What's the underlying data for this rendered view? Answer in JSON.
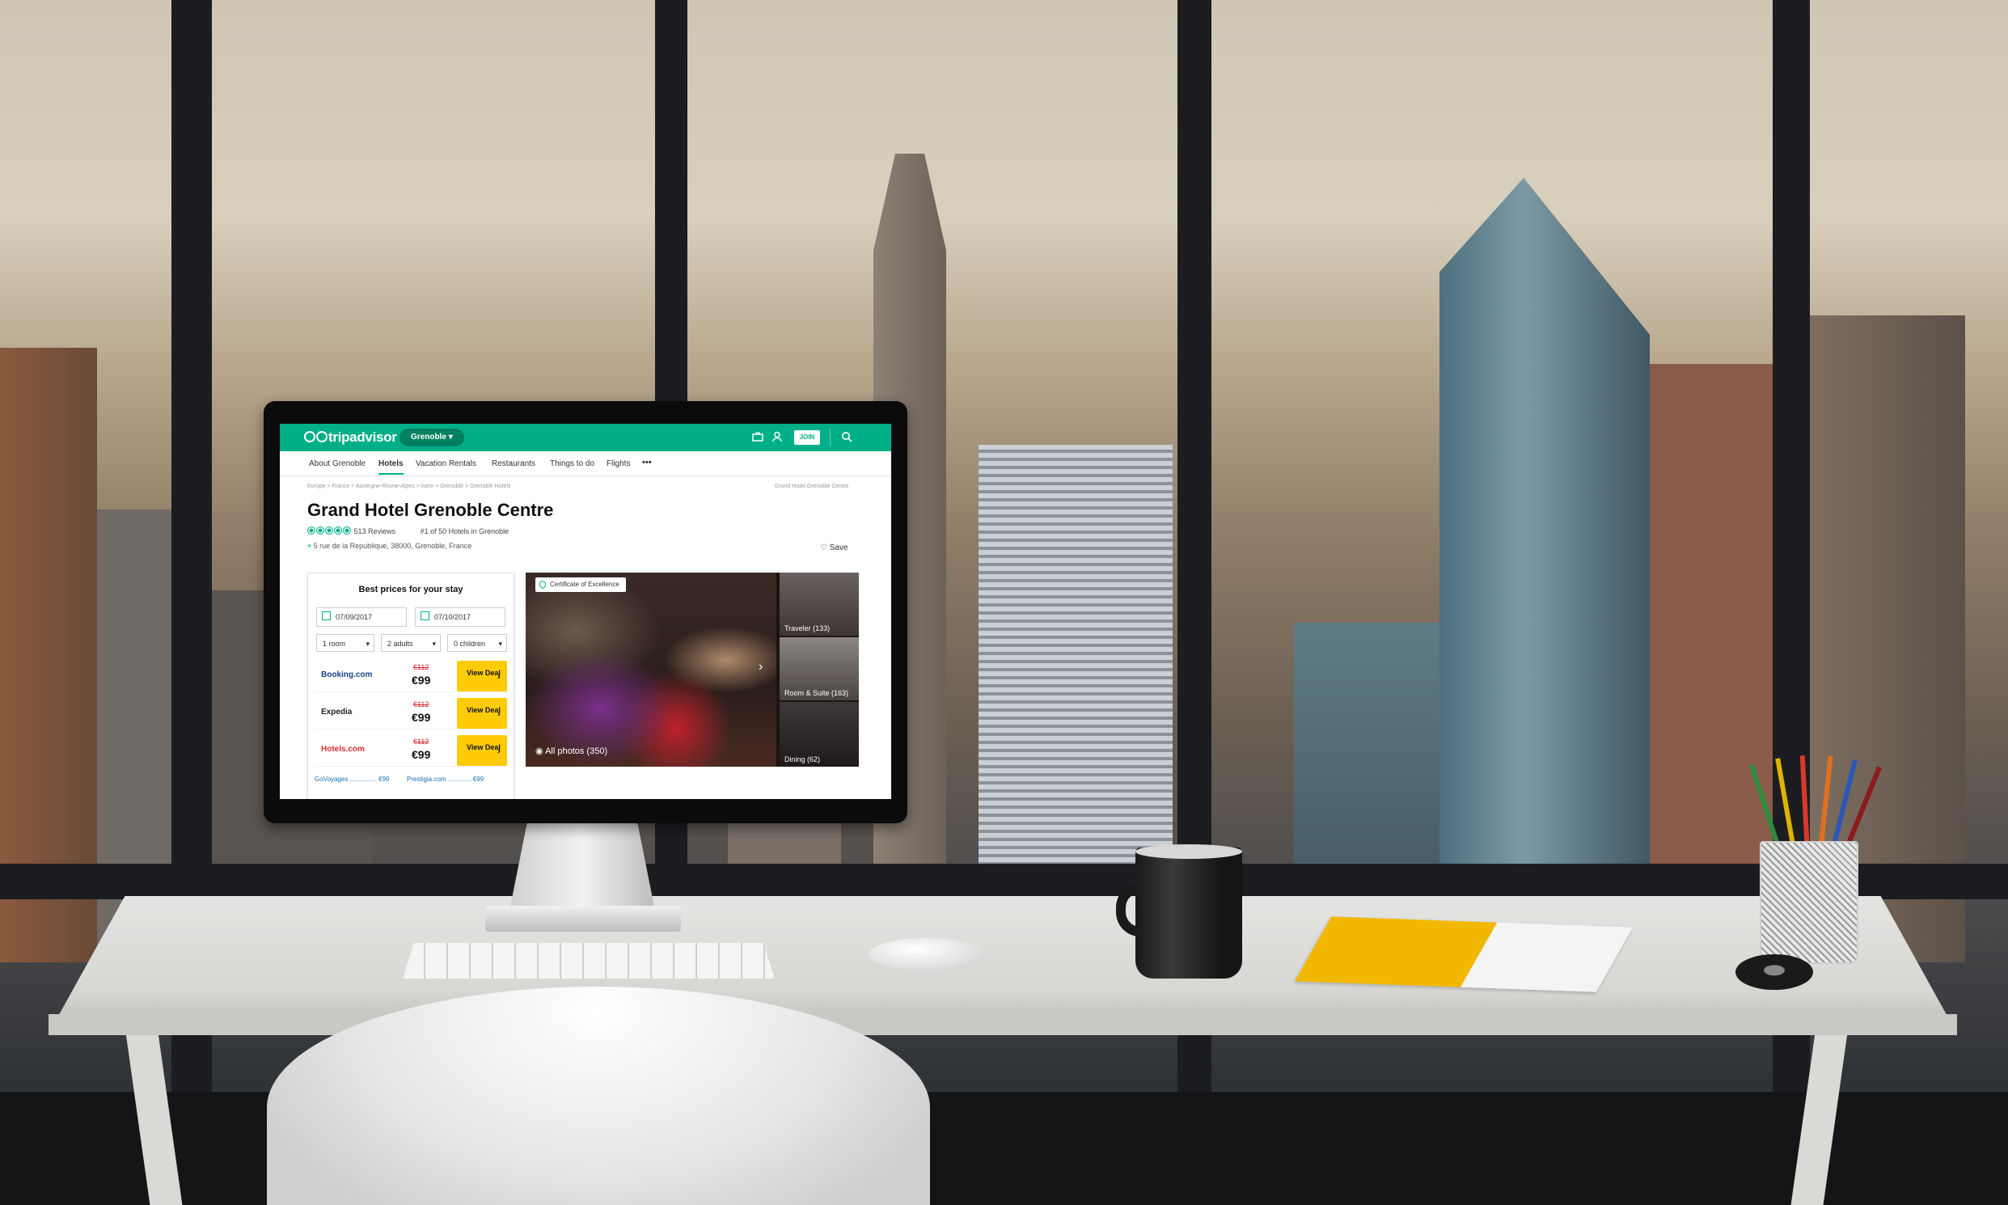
{
  "app": {
    "logo_text": "tripadvisor",
    "location_selector": "Grenoble",
    "join_label": "JOIN"
  },
  "nav": {
    "items": [
      "About Grenoble",
      "Hotels",
      "Vacation Rentals",
      "Restaurants",
      "Things to do",
      "Flights"
    ],
    "active": "Hotels",
    "more_label": "•••"
  },
  "breadcrumb": {
    "items": [
      "Europe",
      "France",
      "Auvergne-Rhone-Alpes",
      "Isere",
      "Grenoble",
      "Grenoble Hotels"
    ],
    "right": "Grand Hotel Grenoble Centre"
  },
  "hotel": {
    "name": "Grand Hotel Grenoble Centre",
    "reviews": "513 Reviews",
    "rank": "#1 of 50 Hotels in Grenoble",
    "address": "5 rue de la Republique, 38000, Grenoble, France",
    "save_label": "Save",
    "rating_bubbles": 5
  },
  "prices": {
    "heading": "Best prices for your stay",
    "check_in": "07/09/2017",
    "check_out": "07/10/2017",
    "rooms": "1 room",
    "adults": "2 adults",
    "children": "0 children",
    "deals": [
      {
        "brand": "Booking.com",
        "old_price": "€112",
        "new_price": "€99",
        "button": "View Deal"
      },
      {
        "brand": "Expedia",
        "old_price": "€112",
        "new_price": "€99",
        "button": "View Deal"
      },
      {
        "brand": "Hotels.com",
        "old_price": "€112",
        "new_price": "€99",
        "button": "View Deal"
      }
    ],
    "mini_deals": [
      "GoVoyages ............... €99",
      "Prestigia.com ............. €99"
    ]
  },
  "photos": {
    "certificate": "Certificate of Excellence",
    "all_photos": "All photos (350)",
    "thumbs": [
      "Traveler (133)",
      "Room & Suite (163)",
      "Dining (62)"
    ]
  },
  "colors": {
    "brand_green": "#00af87",
    "deal_yellow": "#ffcb05",
    "old_price_red": "#d6262f"
  }
}
